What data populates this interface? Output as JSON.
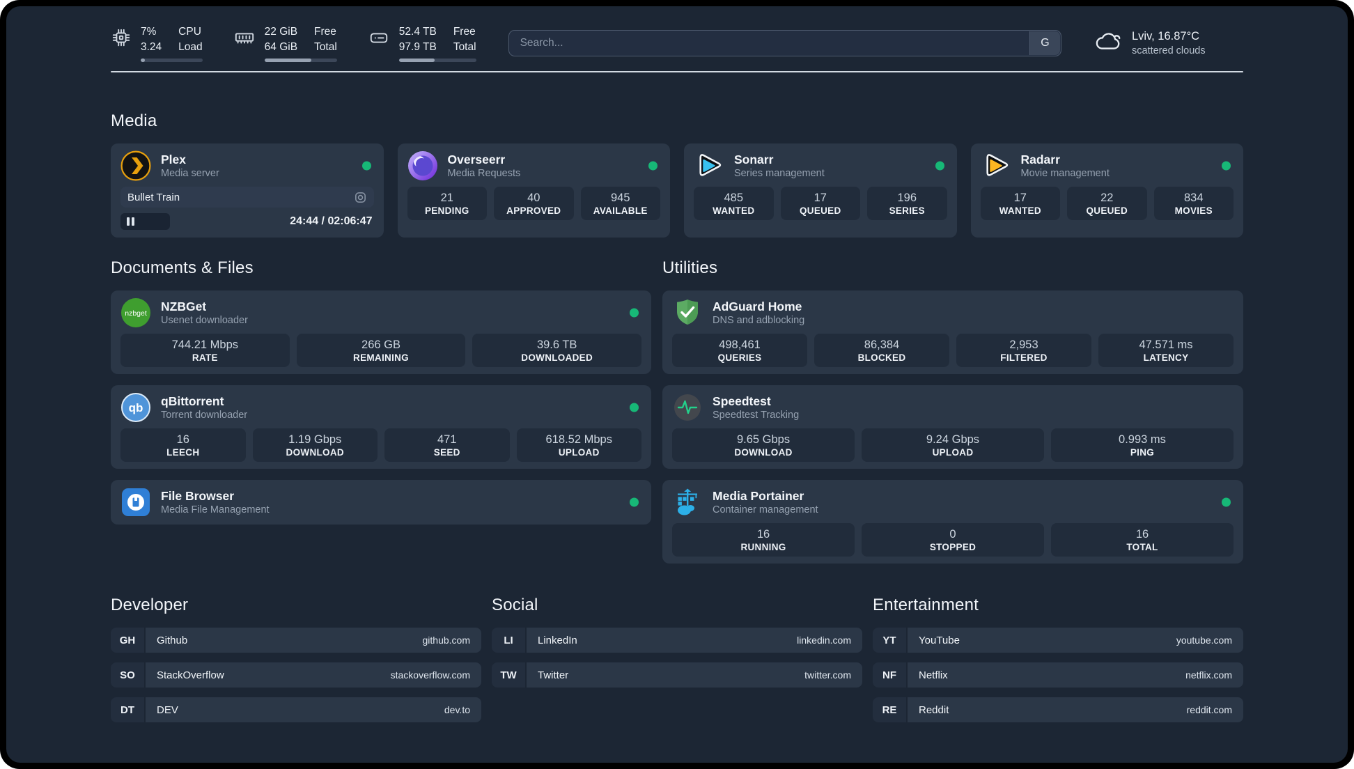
{
  "topbar": {
    "system_stats": [
      {
        "value_top": "7%",
        "value_bottom": "3.24",
        "label_top": "CPU",
        "label_bottom": "Load",
        "progress_pct": 7
      },
      {
        "value_top": "22 GiB",
        "value_bottom": "64 GiB",
        "label_top": "Free",
        "label_bottom": "Total",
        "progress_pct": 65
      },
      {
        "value_top": "52.4 TB",
        "value_bottom": "97.9 TB",
        "label_top": "Free",
        "label_bottom": "Total",
        "progress_pct": 46
      }
    ],
    "search": {
      "placeholder": "Search...",
      "engine_button": "G"
    },
    "weather": {
      "location_temp": "Lviv, 16.87°C",
      "condition": "scattered clouds"
    }
  },
  "media": {
    "heading": "Media",
    "plex": {
      "name": "Plex",
      "description": "Media server",
      "status": "online",
      "now_playing": {
        "title": "Bullet Train",
        "time_display": "24:44 / 02:06:47",
        "state": "paused",
        "progress_pct": 19.5
      }
    },
    "overseerr": {
      "name": "Overseerr",
      "description": "Media Requests",
      "status": "online",
      "stats": [
        {
          "value": "21",
          "label": "PENDING"
        },
        {
          "value": "40",
          "label": "APPROVED"
        },
        {
          "value": "945",
          "label": "AVAILABLE"
        }
      ]
    },
    "sonarr": {
      "name": "Sonarr",
      "description": "Series management",
      "status": "online",
      "stats": [
        {
          "value": "485",
          "label": "WANTED"
        },
        {
          "value": "17",
          "label": "QUEUED"
        },
        {
          "value": "196",
          "label": "SERIES"
        }
      ]
    },
    "radarr": {
      "name": "Radarr",
      "description": "Movie management",
      "status": "online",
      "stats": [
        {
          "value": "17",
          "label": "WANTED"
        },
        {
          "value": "22",
          "label": "QUEUED"
        },
        {
          "value": "834",
          "label": "MOVIES"
        }
      ]
    }
  },
  "documents": {
    "heading": "Documents & Files",
    "nzbget": {
      "name": "NZBGet",
      "description": "Usenet downloader",
      "status": "online",
      "stats": [
        {
          "value": "744.21 Mbps",
          "label": "RATE"
        },
        {
          "value": "266 GB",
          "label": "REMAINING"
        },
        {
          "value": "39.6 TB",
          "label": "DOWNLOADED"
        }
      ]
    },
    "qbittorrent": {
      "name": "qBittorrent",
      "description": "Torrent downloader",
      "status": "online",
      "stats": [
        {
          "value": "16",
          "label": "LEECH"
        },
        {
          "value": "1.19 Gbps",
          "label": "DOWNLOAD"
        },
        {
          "value": "471",
          "label": "SEED"
        },
        {
          "value": "618.52 Mbps",
          "label": "UPLOAD"
        }
      ]
    },
    "filebrowser": {
      "name": "File Browser",
      "description": "Media File Management",
      "status": "online"
    }
  },
  "utilities": {
    "heading": "Utilities",
    "adguard": {
      "name": "AdGuard Home",
      "description": "DNS and adblocking",
      "stats": [
        {
          "value": "498,461",
          "label": "QUERIES"
        },
        {
          "value": "86,384",
          "label": "BLOCKED"
        },
        {
          "value": "2,953",
          "label": "FILTERED"
        },
        {
          "value": "47.571 ms",
          "label": "LATENCY"
        }
      ]
    },
    "speedtest": {
      "name": "Speedtest",
      "description": "Speedtest Tracking",
      "stats": [
        {
          "value": "9.65 Gbps",
          "label": "DOWNLOAD"
        },
        {
          "value": "9.24 Gbps",
          "label": "UPLOAD"
        },
        {
          "value": "0.993 ms",
          "label": "PING"
        }
      ]
    },
    "portainer": {
      "name": "Media Portainer",
      "description": "Container management",
      "status": "online",
      "stats": [
        {
          "value": "16",
          "label": "RUNNING"
        },
        {
          "value": "0",
          "label": "STOPPED"
        },
        {
          "value": "16",
          "label": "TOTAL"
        }
      ]
    }
  },
  "bookmarks": {
    "developer": {
      "heading": "Developer",
      "items": [
        {
          "abbr": "GH",
          "name": "Github",
          "domain": "github.com"
        },
        {
          "abbr": "SO",
          "name": "StackOverflow",
          "domain": "stackoverflow.com"
        },
        {
          "abbr": "DT",
          "name": "DEV",
          "domain": "dev.to"
        }
      ]
    },
    "social": {
      "heading": "Social",
      "items": [
        {
          "abbr": "LI",
          "name": "LinkedIn",
          "domain": "linkedin.com"
        },
        {
          "abbr": "TW",
          "name": "Twitter",
          "domain": "twitter.com"
        }
      ]
    },
    "entertainment": {
      "heading": "Entertainment",
      "items": [
        {
          "abbr": "YT",
          "name": "YouTube",
          "domain": "youtube.com"
        },
        {
          "abbr": "NF",
          "name": "Netflix",
          "domain": "netflix.com"
        },
        {
          "abbr": "RE",
          "name": "Reddit",
          "domain": "reddit.com"
        }
      ]
    }
  },
  "icons": {
    "nzbget_text": "nzbget",
    "qbittorrent_text": "qb"
  },
  "colors": {
    "status_online": "#17b877",
    "plex": "#e8a00d",
    "sonarr": "#38c1ef",
    "radarr": "#fdb621",
    "nzbget": "#3f9e2f",
    "qbittorrent": "#4f94d9",
    "adguard": "#5cab63",
    "speedtest_pulse": "#23d18b",
    "filebrowser": "#2f7fd6",
    "portainer": "#2cb0e8"
  }
}
